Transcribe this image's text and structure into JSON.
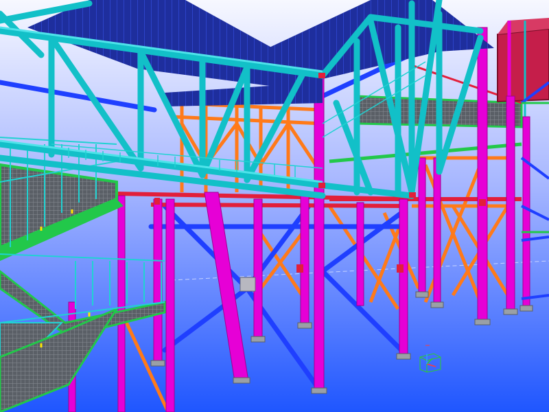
{
  "scene": {
    "subject": "steel-structure-3d-model",
    "colors": {
      "sky_top": "#f7f8ff",
      "sky_mid": "#a6b6ff",
      "sky_bottom": "#1f56ff",
      "truss_cyan": "#12c0c8",
      "truss_cyan_light": "#4fe3ea",
      "roof_blue": "#1e2e9d",
      "roof_blue_light": "#2d43c9",
      "column_magenta": "#e600d6",
      "brace_blue": "#1f3fff",
      "brace_orange": "#ff7a1a",
      "beam_red": "#e21f3a",
      "platform_green": "#22c84a",
      "stair_cyan": "#20d2d2",
      "stair_step": "#7b7f86",
      "block_red": "#c51e4a",
      "pad_gray": "#9aa0a6",
      "handrail_yellow": "#ffe600",
      "axis_red": "#ff3b3b",
      "axis_green": "#2bd12b",
      "axis_blue": "#2aa0ff"
    }
  }
}
